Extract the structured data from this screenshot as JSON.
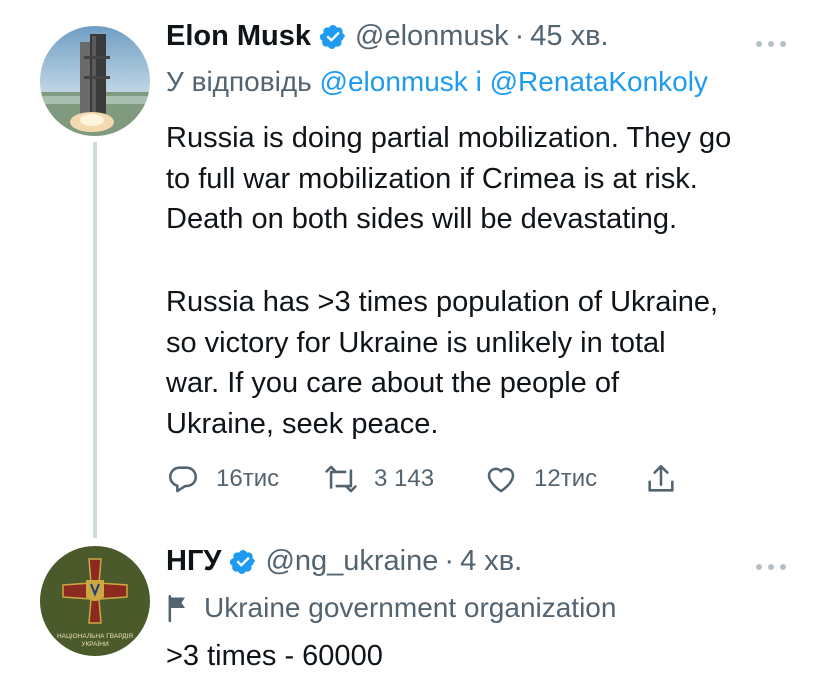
{
  "tweet1": {
    "author_name": "Elon Musk",
    "handle": "@elonmusk",
    "separator": "·",
    "time": "45 хв.",
    "reply_prefix": "У відповідь",
    "reply_handle1": "@elonmusk",
    "reply_joiner": "і",
    "reply_handle2": "@RenataKonkoly",
    "paragraph1": [
      "Russia is doing partial mobilization. They go",
      "to full war mobilization if Crimea is at risk.",
      "Death on both sides will be devastating."
    ],
    "paragraph2": [
      "Russia has >3 times population of Ukraine,",
      "so victory for Ukraine is unlikely in total",
      "war. If you care about the people of",
      "Ukraine, seek peace."
    ],
    "actions": {
      "replies": "16тис",
      "retweets": "3 143",
      "likes": "12тис"
    }
  },
  "tweet2": {
    "author_name": "НГУ",
    "handle": "@ng_ukraine",
    "separator": "·",
    "time": "4 хв.",
    "label": "Ukraine government organization",
    "text": ">3 times - 60000",
    "avatar_caption_line1": "НАЦІОНАЛЬНА ГВАРДІЯ",
    "avatar_caption_line2": "УКРАЇНИ"
  },
  "icons": {
    "verified": "verified-badge-icon",
    "more": "more-dots-icon",
    "reply": "reply-bubble-icon",
    "retweet": "retweet-icon",
    "like": "heart-icon",
    "share": "share-icon",
    "flag": "flag-icon"
  },
  "colors": {
    "accent": "#1d9bf0",
    "text": "#0f1419",
    "muted": "#536471",
    "thread_line": "#cfd9de",
    "ngu_green": "#4b5a2a"
  }
}
